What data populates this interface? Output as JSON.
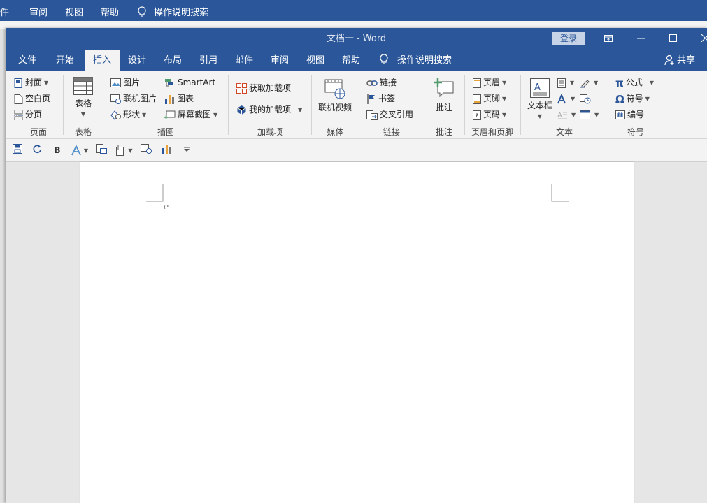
{
  "background_window": {
    "menu": [
      "件",
      "审阅",
      "视图",
      "帮助"
    ],
    "search_label": "操作说明搜索"
  },
  "window": {
    "title": "文档一 - Word",
    "login_label": "登录",
    "share_label": "共享"
  },
  "tabs": [
    "文件",
    "开始",
    "插入",
    "设计",
    "布局",
    "引用",
    "邮件",
    "审阅",
    "视图",
    "帮助"
  ],
  "active_tab": "插入",
  "tell_me": "操作说明搜索",
  "ribbon": {
    "pages": {
      "items": [
        "封面",
        "空白页",
        "分页"
      ],
      "label": "页面"
    },
    "tables": {
      "button": "表格",
      "label": "表格"
    },
    "illustrations": {
      "items": [
        "图片",
        "联机图片",
        "形状",
        "SmartArt",
        "图表",
        "屏幕截图"
      ],
      "label": "插图"
    },
    "addins": {
      "items": [
        "获取加载项",
        "我的加载项"
      ],
      "label": "加载项"
    },
    "media": {
      "button": "联机视频",
      "label": "媒体"
    },
    "links": {
      "items": [
        "链接",
        "书签",
        "交叉引用"
      ],
      "label": "链接"
    },
    "comments": {
      "button": "批注",
      "label": "批注"
    },
    "header_footer": {
      "items": [
        "页眉",
        "页脚",
        "页码"
      ],
      "label": "页眉和页脚"
    },
    "text": {
      "button": "文本框",
      "label": "文本"
    },
    "symbols": {
      "items": [
        "公式",
        "符号",
        "编号"
      ],
      "label": "符号"
    }
  },
  "quick_access": {
    "bold": "B"
  },
  "document": {
    "paragraph_mark": "↵"
  },
  "colors": {
    "accent": "#2b579a",
    "ribbon_bg": "#f3f3f3",
    "canvas_bg": "#e6e6e6"
  }
}
